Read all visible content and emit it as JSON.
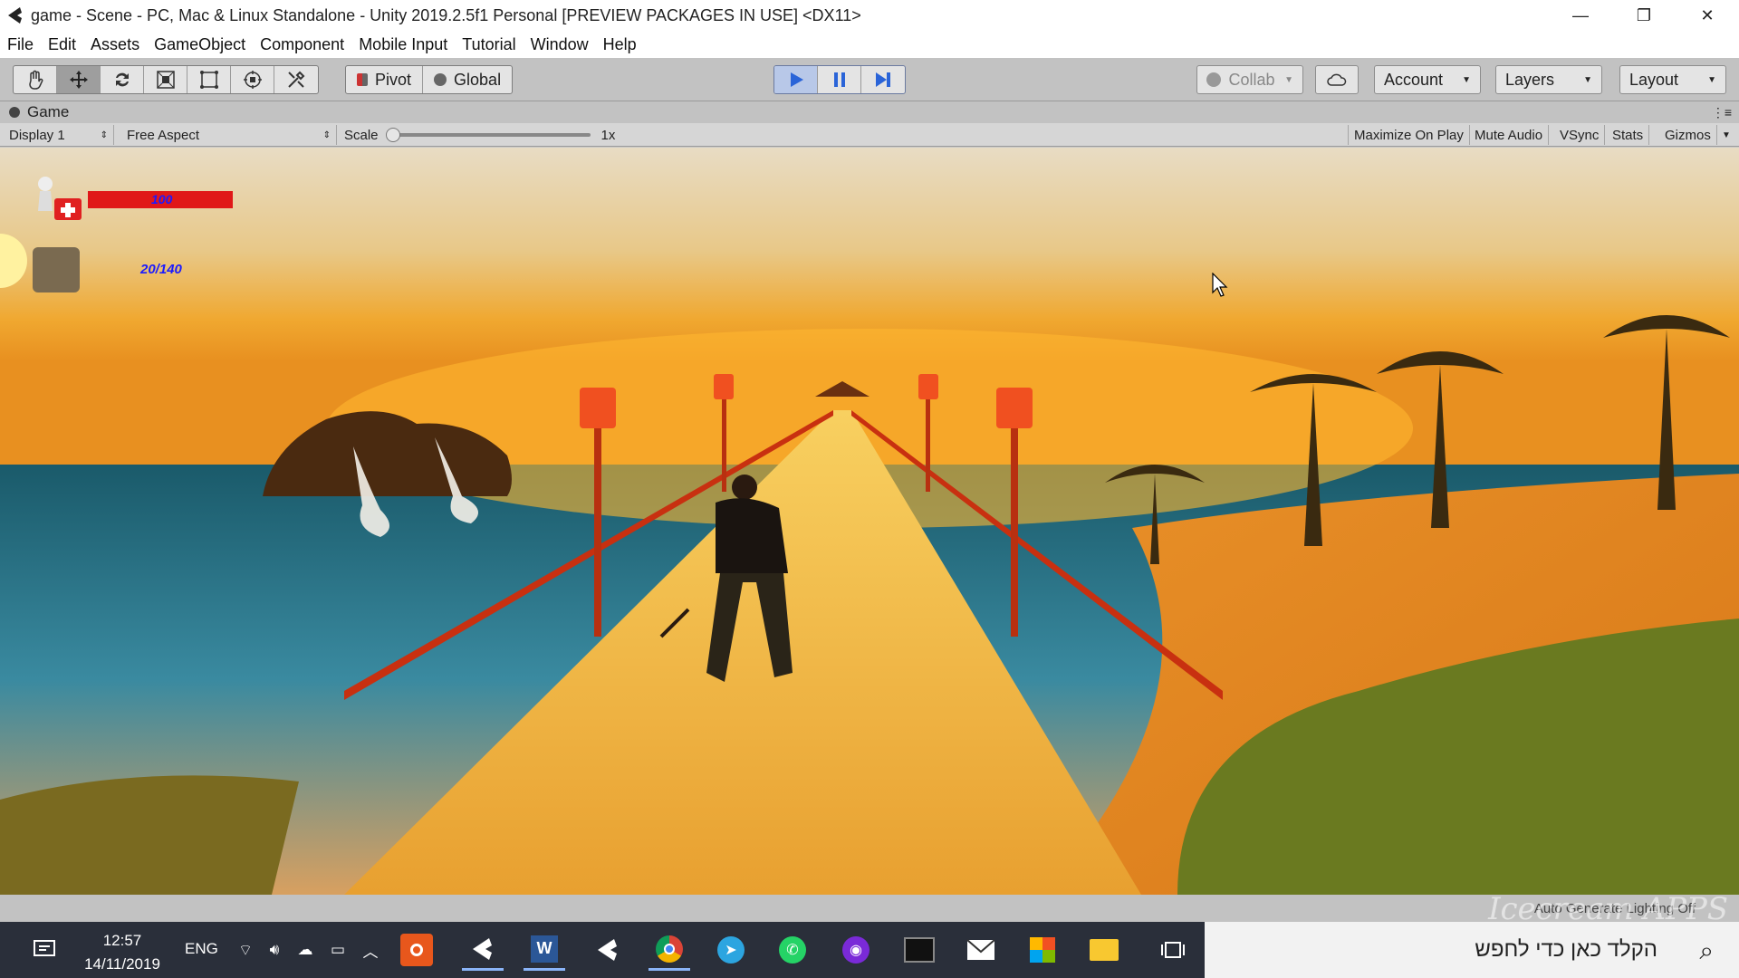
{
  "window": {
    "title": "game - Scene - PC, Mac & Linux Standalone - Unity 2019.2.5f1 Personal [PREVIEW PACKAGES IN USE] <DX11>",
    "minimize": "—",
    "maximize": "❐",
    "close": "✕"
  },
  "menu": [
    "File",
    "Edit",
    "Assets",
    "GameObject",
    "Component",
    "Mobile Input",
    "Tutorial",
    "Window",
    "Help"
  ],
  "toolbar": {
    "tools": [
      "hand-icon",
      "move-icon",
      "rotate-icon",
      "scale-icon",
      "rect-icon",
      "transform-icon",
      "custom-tool-icon"
    ],
    "pivot_label": "Pivot",
    "global_label": "Global",
    "collab_label": "Collab",
    "account_label": "Account",
    "layers_label": "Layers",
    "layout_label": "Layout"
  },
  "tab": {
    "label": "Game"
  },
  "gamebar": {
    "display": "Display 1",
    "aspect": "Free Aspect",
    "scale_label": "Scale",
    "scale_value": "1x",
    "maximize_on_play": "Maximize On Play",
    "mute_audio": "Mute Audio",
    "vsync": "VSync",
    "stats": "Stats",
    "gizmos": "Gizmos"
  },
  "hud": {
    "health_value": "100",
    "health_fraction": 1.0,
    "ammo": "20/140"
  },
  "status": {
    "lighting": "Auto Generate Lighting Off"
  },
  "watermark": "Icecream APPS",
  "taskbar": {
    "time": "12:57",
    "date": "14/11/2019",
    "lang": "ENG",
    "search_placeholder": "הקלד כאן כדי לחפש"
  },
  "colors": {
    "health_bar": "#e01818",
    "hud_text": "#1a1aff",
    "play_button": "#2a64d8"
  }
}
